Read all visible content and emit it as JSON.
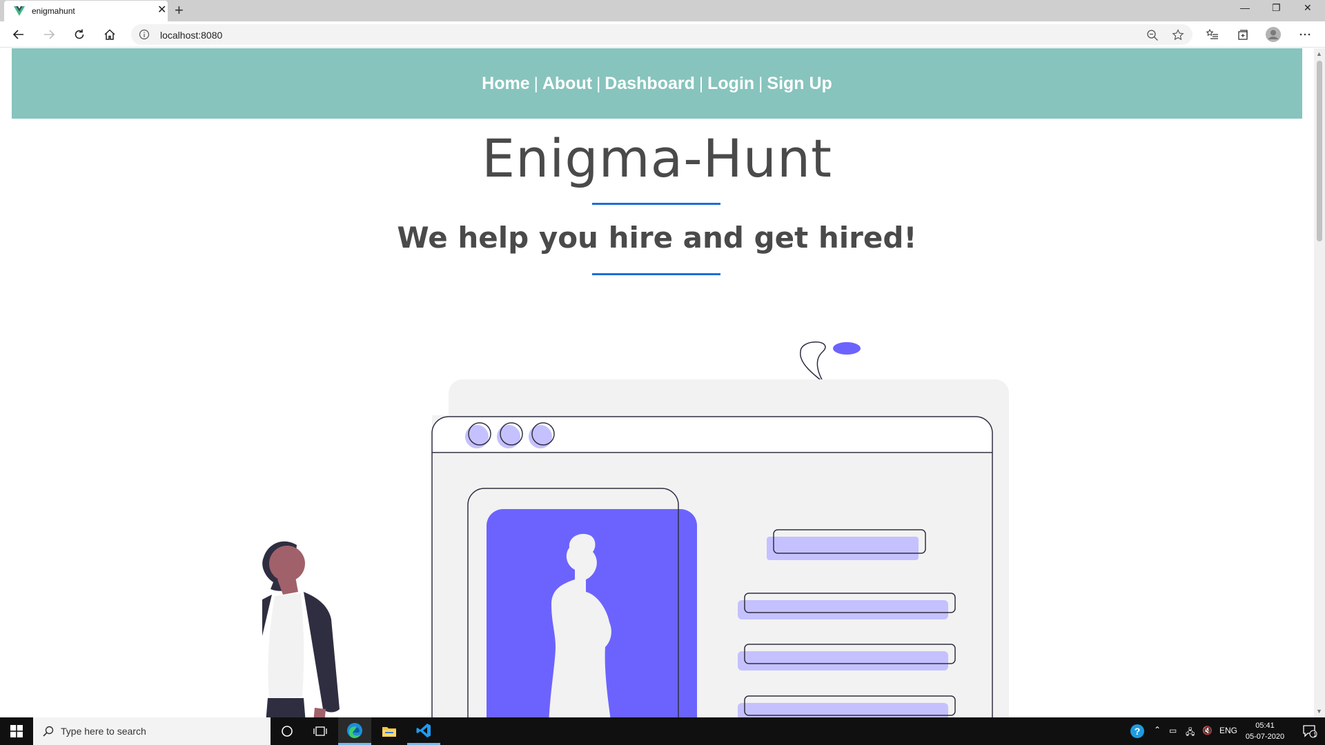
{
  "browser": {
    "tab_title": "enigmahunt",
    "url": "localhost:8080",
    "icons": [
      "vue-favicon",
      "close-icon",
      "plus-icon",
      "back-icon",
      "forward-icon",
      "refresh-icon",
      "home-icon",
      "info-icon",
      "zoom-icon",
      "star-icon",
      "favorites-icon",
      "collections-icon",
      "profile-icon",
      "more-icon"
    ]
  },
  "site": {
    "nav": {
      "home": "Home",
      "about": "About",
      "dashboard": "Dashboard",
      "login": "Login",
      "signup": "Sign Up",
      "separator": "|"
    },
    "title": "Enigma-Hunt",
    "subtitle": "We help you hire and get hired!",
    "colors": {
      "header_bg": "#87c4bd",
      "accent_rule": "#1a6fd9",
      "illustration_primary": "#6c63ff",
      "text": "#4a4a4a"
    }
  },
  "taskbar": {
    "search_placeholder": "Type here to search",
    "language": "ENG",
    "time": "05:41",
    "date": "05-07-2020",
    "notification_count": "1"
  }
}
